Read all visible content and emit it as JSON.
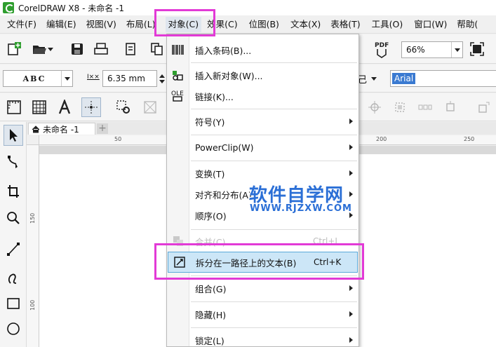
{
  "window": {
    "title": "CorelDRAW X8 - 未命名 -1"
  },
  "menubar": {
    "items": [
      {
        "label": "文件(F)"
      },
      {
        "label": "编辑(E)"
      },
      {
        "label": "视图(V)"
      },
      {
        "label": "布局(L)"
      },
      {
        "label": "对象(C)"
      },
      {
        "label": "效果(C)"
      },
      {
        "label": "位图(B)"
      },
      {
        "label": "文本(X)"
      },
      {
        "label": "表格(T)"
      },
      {
        "label": "工具(O)"
      },
      {
        "label": "窗口(W)"
      },
      {
        "label": "帮助("
      }
    ],
    "active_index": 4
  },
  "toolbar1": {
    "zoom_value": "66%",
    "pdf_label": "PDF"
  },
  "toolbar2": {
    "font_preview": "ABC",
    "nudge_value": "6.35 mm",
    "font_name": "Arial"
  },
  "doc": {
    "tab_label": "未命名 -1",
    "add_tab": "+"
  },
  "ruler": {
    "h_labels": [
      "50",
      "200",
      "250"
    ],
    "v_labels": [
      "150",
      "100"
    ]
  },
  "object_menu": {
    "items": [
      {
        "label": "插入条码(B)...",
        "shortcut": "",
        "submenu": false,
        "disabled": false,
        "icon": "barcode-icon"
      },
      {
        "label": "插入新对象(W)...",
        "shortcut": "",
        "submenu": false,
        "disabled": false,
        "icon": "insert-object-icon"
      },
      {
        "label": "链接(K)...",
        "shortcut": "",
        "submenu": false,
        "disabled": false,
        "icon": "ole-link-icon"
      },
      {
        "label": "符号(Y)",
        "shortcut": "",
        "submenu": true,
        "disabled": false,
        "icon": ""
      },
      {
        "label": "PowerClip(W)",
        "shortcut": "",
        "submenu": true,
        "disabled": false,
        "icon": ""
      },
      {
        "label": "变换(T)",
        "shortcut": "",
        "submenu": true,
        "disabled": false,
        "icon": ""
      },
      {
        "label": "对齐和分布(A)",
        "shortcut": "",
        "submenu": true,
        "disabled": false,
        "icon": ""
      },
      {
        "label": "顺序(O)",
        "shortcut": "",
        "submenu": true,
        "disabled": false,
        "icon": ""
      },
      {
        "label": "合并(C)",
        "shortcut": "Ctrl+L",
        "submenu": false,
        "disabled": true,
        "icon": "combine-icon"
      },
      {
        "label": "拆分在一路径上的文本(B)",
        "shortcut": "Ctrl+K",
        "submenu": false,
        "disabled": false,
        "icon": "break-apart-icon",
        "highlighted": true
      },
      {
        "label": "组合(G)",
        "shortcut": "",
        "submenu": true,
        "disabled": false,
        "icon": ""
      },
      {
        "label": "隐藏(H)",
        "shortcut": "",
        "submenu": true,
        "disabled": false,
        "icon": ""
      },
      {
        "label": "锁定(L)",
        "shortcut": "",
        "submenu": true,
        "disabled": false,
        "icon": ""
      }
    ]
  },
  "watermark": {
    "main": "软件自学网",
    "sub": "WWW.RJZXW.COM"
  },
  "colors": {
    "highlight_magenta": "#e23ad6",
    "menu_hover": "#cce6f7",
    "watermark_blue": "#2b6fd6"
  }
}
